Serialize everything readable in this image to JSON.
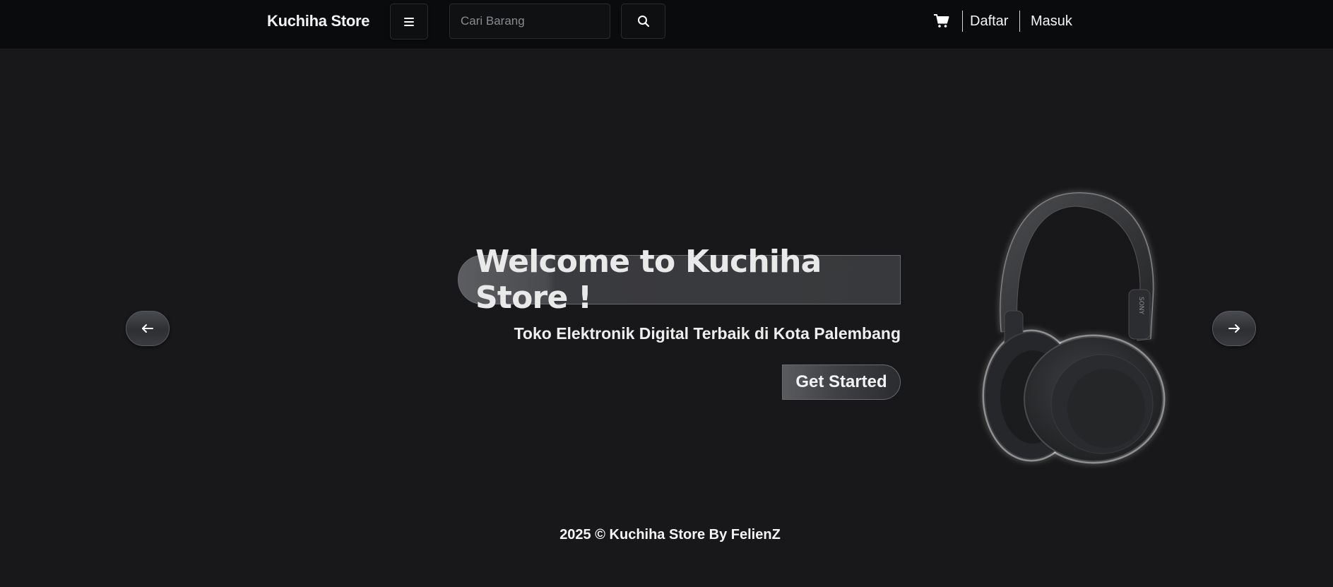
{
  "navbar": {
    "brand": "Kuchiha Store",
    "menu_icon": "hamburger-icon",
    "search": {
      "placeholder": "Cari Barang",
      "value": "",
      "icon": "search-icon"
    },
    "cart_icon": "cart-icon",
    "links": [
      "Daftar",
      "Masuk"
    ]
  },
  "hero": {
    "title": "Welcome to Kuchiha Store !",
    "subtitle": "Toko Elektronik Digital Terbaik di Kota Palembang",
    "cta_label": "Get Started",
    "prev_icon": "arrow-left-icon",
    "next_icon": "arrow-right-icon",
    "product_image": "headphones-image",
    "product_brand_mark": "SONY"
  },
  "footer": {
    "text": "2025 © Kuchiha Store By FelienZ"
  },
  "colors": {
    "background": "#18181a",
    "navbar": "#0a0b0d",
    "text": "#ffffff"
  }
}
